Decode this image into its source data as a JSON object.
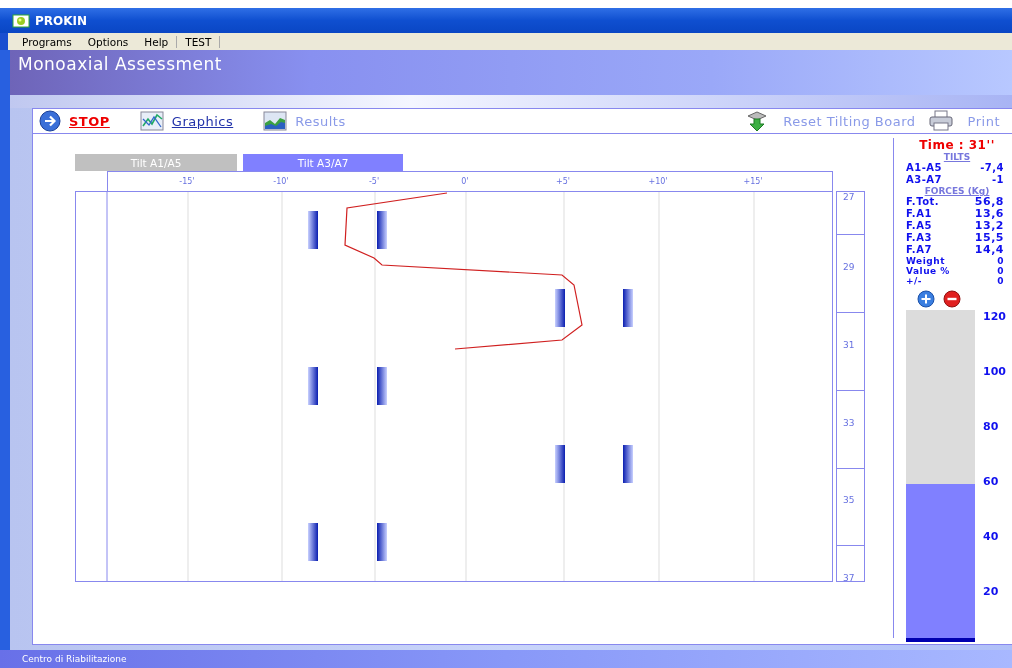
{
  "window": {
    "title": "PROKIN"
  },
  "menu": [
    {
      "label": "Programs"
    },
    {
      "label": "Options"
    },
    {
      "label": "Help"
    },
    {
      "label": "TEST"
    }
  ],
  "header": {
    "title": "Monoaxial Assessment"
  },
  "toolbar": [
    {
      "label": "STOP",
      "kind": "stop",
      "disabled": false
    },
    {
      "label": "Graphics",
      "kind": "graphics",
      "disabled": false
    },
    {
      "label": "Results",
      "kind": "results",
      "disabled": true
    }
  ],
  "toolbar_right": [
    {
      "label": "Reset Tilting Board",
      "kind": "reset",
      "disabled": true
    },
    {
      "label": "Print",
      "kind": "print",
      "disabled": true
    }
  ],
  "tabs": [
    {
      "label": "Tilt A1/A5",
      "selected": false
    },
    {
      "label": "Tilt A3/A7",
      "selected": true
    }
  ],
  "axis_labels": [
    "-15'",
    "-10'",
    "-5'",
    "0'",
    "+5'",
    "+10'",
    "+15'"
  ],
  "time_labels": [
    "27",
    "29",
    "31",
    "33",
    "35",
    "37"
  ],
  "panel": {
    "time": "Time : 31''",
    "tilts_heading": "TILTS",
    "tilts": [
      {
        "name": "A1-A5",
        "value": "-7,4"
      },
      {
        "name": "A3-A7",
        "value": "-1"
      }
    ],
    "forces_heading": "FORCES (Kg)",
    "forces": [
      {
        "name": "F.Tot.",
        "value": "56,8"
      },
      {
        "name": "F.A1",
        "value": "13,6"
      },
      {
        "name": "F.A5",
        "value": "13,2"
      },
      {
        "name": "F.A3",
        "value": "15,5"
      },
      {
        "name": "F.A7",
        "value": "14,4"
      }
    ],
    "extras": [
      {
        "name": "Weight",
        "value": "0"
      },
      {
        "name": "Value %",
        "value": "0"
      },
      {
        "name": "+/-",
        "value": "0"
      }
    ],
    "gauge": {
      "level": 0.47,
      "scale": [
        "120",
        "100",
        "80",
        "60",
        "40",
        "20"
      ]
    }
  },
  "status_bar": {
    "text": "Centro di Riabilitazione"
  }
}
